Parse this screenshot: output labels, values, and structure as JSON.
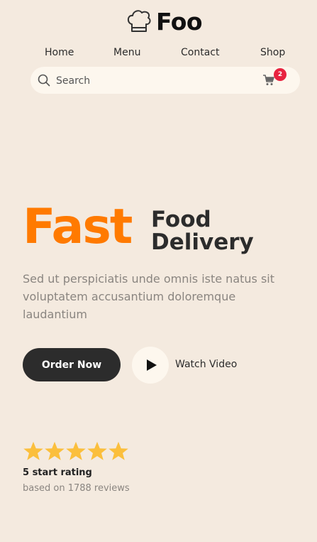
{
  "brand": {
    "name": "Foo",
    "icon": "chef-hat-icon"
  },
  "nav": {
    "items": [
      "Home",
      "Menu",
      "Contact",
      "Shop"
    ]
  },
  "search": {
    "placeholder": "Search",
    "icon": "search-icon"
  },
  "cart": {
    "icon": "cart-icon",
    "count": "2"
  },
  "hero": {
    "title_accent": "Fast",
    "title_line1": "Food",
    "title_line2": "Delivery",
    "description": "Sed ut perspiciatis unde omnis iste natus sit voluptatem accusantium doloremque laudantium",
    "order_label": "Order Now",
    "watch_label": "Watch Video",
    "play_icon": "play-icon"
  },
  "rating": {
    "stars": 5,
    "title": "5 start rating",
    "subtitle": "based on 1788 reviews"
  },
  "colors": {
    "background": "#f4eadf",
    "accent": "#ff7a00",
    "dark": "#2c2c2c",
    "badge": "#e8233f",
    "star": "#fbbf3c",
    "muted": "#8a8580"
  }
}
